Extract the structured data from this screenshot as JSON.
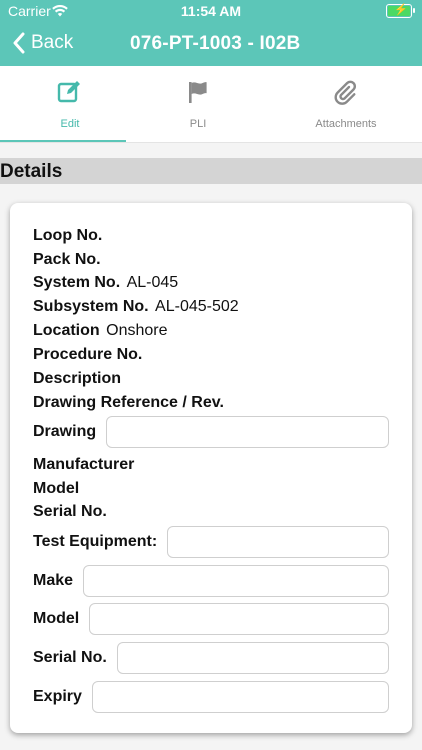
{
  "status": {
    "carrier": "Carrier",
    "time": "11:54 AM"
  },
  "nav": {
    "back_label": "Back",
    "title": "076-PT-1003 - I02B"
  },
  "tabs": [
    {
      "label": "Edit",
      "icon": "edit-icon",
      "active": true
    },
    {
      "label": "PLI",
      "icon": "flag-icon",
      "active": false
    },
    {
      "label": "Attachments",
      "icon": "paperclip-icon",
      "active": false
    }
  ],
  "details": {
    "header": "Details",
    "loop_no": {
      "label": "Loop No.",
      "value": ""
    },
    "pack_no": {
      "label": "Pack No.",
      "value": ""
    },
    "system_no": {
      "label": "System No.",
      "value": "AL-045"
    },
    "subsystem_no": {
      "label": "Subsystem No.",
      "value": "AL-045-502"
    },
    "location": {
      "label": "Location",
      "value": "Onshore"
    },
    "procedure_no": {
      "label": "Procedure No.",
      "value": ""
    },
    "description": {
      "label": "Description",
      "value": ""
    },
    "drawing_ref": {
      "label": "Drawing Reference / Rev.",
      "value": ""
    },
    "drawing": {
      "label": "Drawing",
      "value": ""
    },
    "manufacturer": {
      "label": "Manufacturer",
      "value": ""
    },
    "model": {
      "label": "Model",
      "value": ""
    },
    "serial_no": {
      "label": "Serial No.",
      "value": ""
    },
    "test_equipment": {
      "label": "Test Equipment:",
      "value": ""
    },
    "make": {
      "label": "Make",
      "value": ""
    },
    "te_model": {
      "label": "Model",
      "value": ""
    },
    "te_serial_no": {
      "label": "Serial No.",
      "value": ""
    },
    "expiry": {
      "label": "Expiry",
      "value": ""
    }
  },
  "colors": {
    "accent": "#5cc6b8",
    "active_tab": "#45b9ab",
    "section_header": "#d4d4d4"
  }
}
